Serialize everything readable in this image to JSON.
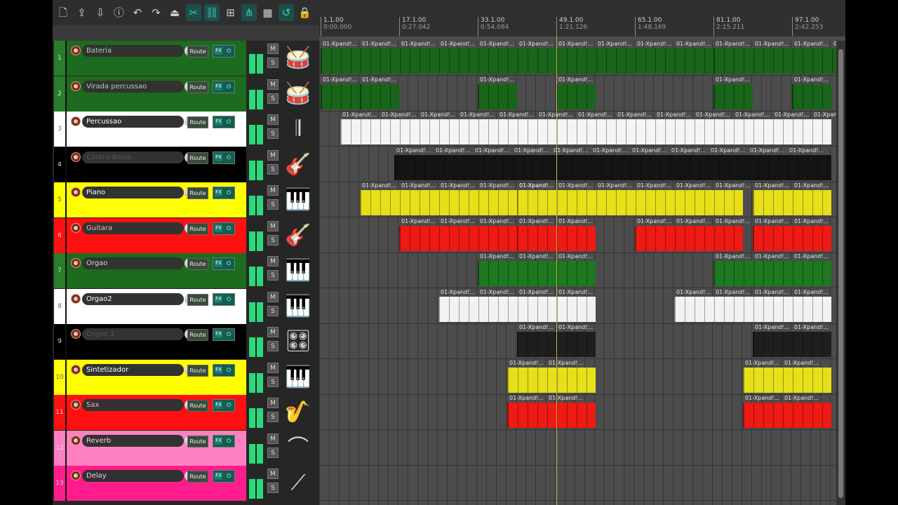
{
  "toolbar": {
    "buttons": [
      {
        "icon": "new-project-icon",
        "glyph": "🗋",
        "active": false
      },
      {
        "icon": "export-icon",
        "glyph": "⇪",
        "active": false
      },
      {
        "icon": "import-icon",
        "glyph": "⇩",
        "active": false
      },
      {
        "icon": "info-icon",
        "glyph": "ⓘ",
        "active": false
      },
      {
        "icon": "undo-icon",
        "glyph": "↶",
        "active": false
      },
      {
        "icon": "redo-icon",
        "glyph": "↷",
        "active": false
      },
      {
        "icon": "metronome-icon",
        "glyph": "⏏",
        "active": false
      },
      {
        "icon": "split-tool-icon",
        "glyph": "✂",
        "active": true
      },
      {
        "icon": "link-icon",
        "glyph": "⛓",
        "active": true
      },
      {
        "icon": "grid-icon",
        "glyph": "⊞",
        "active": false
      },
      {
        "icon": "snap-icon",
        "glyph": "⋔",
        "active": true
      },
      {
        "icon": "envelope-grid-icon",
        "glyph": "▦",
        "active": false
      },
      {
        "icon": "loop-icon",
        "glyph": "↺",
        "active": true
      },
      {
        "icon": "lock-icon",
        "glyph": "🔒",
        "active": false
      }
    ]
  },
  "common": {
    "route_label": "Route",
    "fx_label": "FX",
    "power_label": "⏻",
    "mute_label": "M",
    "solo_label": "S",
    "item_label": "01-Xpand!...",
    "item_label_short": "01-Xpa..."
  },
  "timeline": {
    "ticks": [
      {
        "bar": "1.1.00",
        "time": "0:00.000"
      },
      {
        "bar": "17.1.00",
        "time": "0:27.042"
      },
      {
        "bar": "33.1.00",
        "time": "0:54.084"
      },
      {
        "bar": "49.1.00",
        "time": "1:21.126"
      },
      {
        "bar": "65.1.00",
        "time": "1:48.169"
      },
      {
        "bar": "81.1.00",
        "time": "2:15.211"
      },
      {
        "bar": "97.1.00",
        "time": "2:42.253"
      }
    ],
    "cursor_bar": 49
  },
  "tracks": [
    {
      "num": "1",
      "name": "Bateria",
      "color": "#1c6b1f",
      "numcolor": "#2a7d2a",
      "text": "#aad0aa",
      "item": "#19651a",
      "icon": "drums-icon",
      "glyph": "🥁",
      "items": [
        [
          1,
          81
        ],
        [
          81,
          113
        ],
        [
          113,
          129
        ]
      ]
    },
    {
      "num": "2",
      "name": "Virada percussao",
      "color": "#1c6b1f",
      "numcolor": "#2a7d2a",
      "text": "#aad0aa",
      "item": "#19651a",
      "icon": "drums-icon",
      "glyph": "🥁",
      "items": [
        [
          1,
          9
        ],
        [
          9,
          17
        ],
        [
          33,
          41
        ],
        [
          49,
          57
        ],
        [
          81,
          89
        ],
        [
          97,
          105
        ]
      ]
    },
    {
      "num": "3",
      "name": "Percussao",
      "color": "#ffffff",
      "numcolor": "#ffffff",
      "text": "#ffffff",
      "item": "#f4f4f4",
      "icon": "congas-icon",
      "glyph": "𝄂",
      "items": [
        [
          5,
          105
        ]
      ]
    },
    {
      "num": "4",
      "name": "Contra-Baixo",
      "color": "#000000",
      "numcolor": "#000000",
      "text": "#555555",
      "item": "#141414",
      "icon": "bass-guitar-icon",
      "glyph": "🎸",
      "items": [
        [
          16,
          105
        ]
      ]
    },
    {
      "num": "5",
      "name": "Piano",
      "color": "#ffff00",
      "numcolor": "#ffff00",
      "text": "#ffffff",
      "item": "#e6df1a",
      "icon": "piano-keys-icon",
      "glyph": "🎹",
      "items": [
        [
          9,
          47
        ],
        [
          41,
          87
        ],
        [
          89,
          105
        ]
      ]
    },
    {
      "num": "6",
      "name": "Guitara",
      "color": "#ff1010",
      "numcolor": "#ff1010",
      "text": "#ffb0b0",
      "item": "#ee1a14",
      "icon": "electric-guitar-icon",
      "glyph": "🎸",
      "items": [
        [
          17,
          41
        ],
        [
          41,
          57
        ],
        [
          65,
          87
        ],
        [
          89,
          105
        ]
      ]
    },
    {
      "num": "7",
      "name": "Orgao",
      "color": "#1c6b1f",
      "numcolor": "#2a7d2a",
      "text": "#bfe0bf",
      "item": "#1d781f",
      "icon": "keyboard-icon",
      "glyph": "🎹",
      "items": [
        [
          33,
          57
        ],
        [
          81,
          105
        ]
      ]
    },
    {
      "num": "8",
      "name": "Orgao2",
      "color": "#ffffff",
      "numcolor": "#ffffff",
      "text": "#ffffff",
      "item": "#f2f2f2",
      "icon": "organ-icon",
      "glyph": "🎹",
      "items": [
        [
          25,
          57
        ],
        [
          73,
          105
        ]
      ]
    },
    {
      "num": "9",
      "name": "Orgao 3",
      "color": "#000000",
      "numcolor": "#000000",
      "text": "#555555",
      "item": "#1e1e1e",
      "icon": "synth-icon",
      "glyph": "🎛",
      "items": [
        [
          41,
          57
        ],
        [
          89,
          105
        ]
      ]
    },
    {
      "num": "10",
      "name": "Sintetizador",
      "color": "#ffff00",
      "numcolor": "#ffff00",
      "text": "#ffffff",
      "item": "#e6df1a",
      "icon": "keyboard-icon",
      "glyph": "🎹",
      "items": [
        [
          39,
          57
        ],
        [
          87,
          105
        ]
      ]
    },
    {
      "num": "11",
      "name": "Sax",
      "color": "#ff1010",
      "numcolor": "#ff1010",
      "text": "#ffb0b0",
      "item": "#ee1a14",
      "icon": "saxophone-icon",
      "glyph": "🎷",
      "items": [
        [
          39,
          57
        ],
        [
          87,
          105
        ]
      ]
    },
    {
      "num": "12",
      "name": "Reverb",
      "color": "#ff80c0",
      "numcolor": "#ff80c0",
      "text": "#ffd0e8",
      "item": "#ff80c0",
      "icon": "cymbal-icon",
      "glyph": "⌒",
      "items": []
    },
    {
      "num": "13",
      "name": "Delay",
      "color": "#ff1d8c",
      "numcolor": "#ff1d8c",
      "text": "#ffc0e0",
      "item": "#ff1d8c",
      "icon": "effect-icon",
      "glyph": "⟋",
      "items": []
    }
  ]
}
